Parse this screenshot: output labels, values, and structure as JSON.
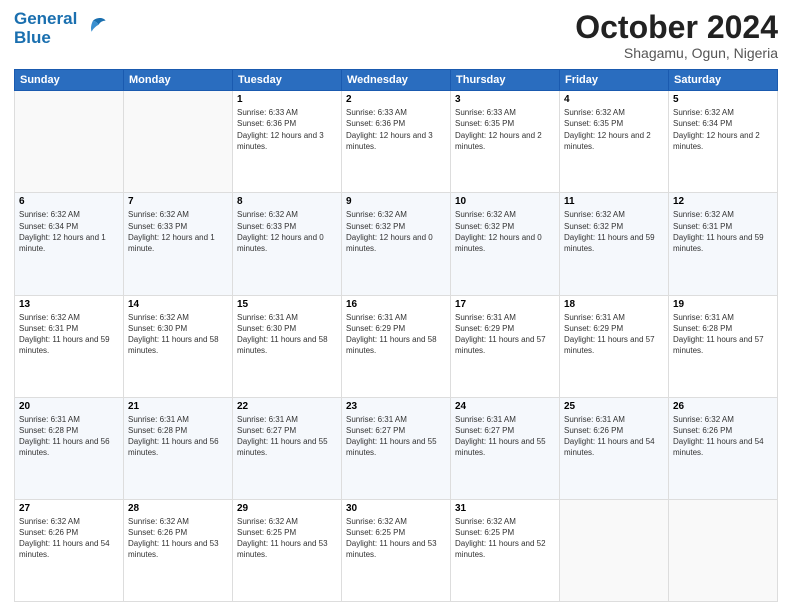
{
  "logo": {
    "line1": "General",
    "line2": "Blue"
  },
  "title": "October 2024",
  "location": "Shagamu, Ogun, Nigeria",
  "days_of_week": [
    "Sunday",
    "Monday",
    "Tuesday",
    "Wednesday",
    "Thursday",
    "Friday",
    "Saturday"
  ],
  "weeks": [
    [
      {
        "day": "",
        "text": ""
      },
      {
        "day": "",
        "text": ""
      },
      {
        "day": "1",
        "text": "Sunrise: 6:33 AM\nSunset: 6:36 PM\nDaylight: 12 hours and 3 minutes."
      },
      {
        "day": "2",
        "text": "Sunrise: 6:33 AM\nSunset: 6:36 PM\nDaylight: 12 hours and 3 minutes."
      },
      {
        "day": "3",
        "text": "Sunrise: 6:33 AM\nSunset: 6:35 PM\nDaylight: 12 hours and 2 minutes."
      },
      {
        "day": "4",
        "text": "Sunrise: 6:32 AM\nSunset: 6:35 PM\nDaylight: 12 hours and 2 minutes."
      },
      {
        "day": "5",
        "text": "Sunrise: 6:32 AM\nSunset: 6:34 PM\nDaylight: 12 hours and 2 minutes."
      }
    ],
    [
      {
        "day": "6",
        "text": "Sunrise: 6:32 AM\nSunset: 6:34 PM\nDaylight: 12 hours and 1 minute."
      },
      {
        "day": "7",
        "text": "Sunrise: 6:32 AM\nSunset: 6:33 PM\nDaylight: 12 hours and 1 minute."
      },
      {
        "day": "8",
        "text": "Sunrise: 6:32 AM\nSunset: 6:33 PM\nDaylight: 12 hours and 0 minutes."
      },
      {
        "day": "9",
        "text": "Sunrise: 6:32 AM\nSunset: 6:32 PM\nDaylight: 12 hours and 0 minutes."
      },
      {
        "day": "10",
        "text": "Sunrise: 6:32 AM\nSunset: 6:32 PM\nDaylight: 12 hours and 0 minutes."
      },
      {
        "day": "11",
        "text": "Sunrise: 6:32 AM\nSunset: 6:32 PM\nDaylight: 11 hours and 59 minutes."
      },
      {
        "day": "12",
        "text": "Sunrise: 6:32 AM\nSunset: 6:31 PM\nDaylight: 11 hours and 59 minutes."
      }
    ],
    [
      {
        "day": "13",
        "text": "Sunrise: 6:32 AM\nSunset: 6:31 PM\nDaylight: 11 hours and 59 minutes."
      },
      {
        "day": "14",
        "text": "Sunrise: 6:32 AM\nSunset: 6:30 PM\nDaylight: 11 hours and 58 minutes."
      },
      {
        "day": "15",
        "text": "Sunrise: 6:31 AM\nSunset: 6:30 PM\nDaylight: 11 hours and 58 minutes."
      },
      {
        "day": "16",
        "text": "Sunrise: 6:31 AM\nSunset: 6:29 PM\nDaylight: 11 hours and 58 minutes."
      },
      {
        "day": "17",
        "text": "Sunrise: 6:31 AM\nSunset: 6:29 PM\nDaylight: 11 hours and 57 minutes."
      },
      {
        "day": "18",
        "text": "Sunrise: 6:31 AM\nSunset: 6:29 PM\nDaylight: 11 hours and 57 minutes."
      },
      {
        "day": "19",
        "text": "Sunrise: 6:31 AM\nSunset: 6:28 PM\nDaylight: 11 hours and 57 minutes."
      }
    ],
    [
      {
        "day": "20",
        "text": "Sunrise: 6:31 AM\nSunset: 6:28 PM\nDaylight: 11 hours and 56 minutes."
      },
      {
        "day": "21",
        "text": "Sunrise: 6:31 AM\nSunset: 6:28 PM\nDaylight: 11 hours and 56 minutes."
      },
      {
        "day": "22",
        "text": "Sunrise: 6:31 AM\nSunset: 6:27 PM\nDaylight: 11 hours and 55 minutes."
      },
      {
        "day": "23",
        "text": "Sunrise: 6:31 AM\nSunset: 6:27 PM\nDaylight: 11 hours and 55 minutes."
      },
      {
        "day": "24",
        "text": "Sunrise: 6:31 AM\nSunset: 6:27 PM\nDaylight: 11 hours and 55 minutes."
      },
      {
        "day": "25",
        "text": "Sunrise: 6:31 AM\nSunset: 6:26 PM\nDaylight: 11 hours and 54 minutes."
      },
      {
        "day": "26",
        "text": "Sunrise: 6:32 AM\nSunset: 6:26 PM\nDaylight: 11 hours and 54 minutes."
      }
    ],
    [
      {
        "day": "27",
        "text": "Sunrise: 6:32 AM\nSunset: 6:26 PM\nDaylight: 11 hours and 54 minutes."
      },
      {
        "day": "28",
        "text": "Sunrise: 6:32 AM\nSunset: 6:26 PM\nDaylight: 11 hours and 53 minutes."
      },
      {
        "day": "29",
        "text": "Sunrise: 6:32 AM\nSunset: 6:25 PM\nDaylight: 11 hours and 53 minutes."
      },
      {
        "day": "30",
        "text": "Sunrise: 6:32 AM\nSunset: 6:25 PM\nDaylight: 11 hours and 53 minutes."
      },
      {
        "day": "31",
        "text": "Sunrise: 6:32 AM\nSunset: 6:25 PM\nDaylight: 11 hours and 52 minutes."
      },
      {
        "day": "",
        "text": ""
      },
      {
        "day": "",
        "text": ""
      }
    ]
  ]
}
